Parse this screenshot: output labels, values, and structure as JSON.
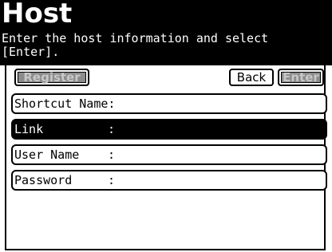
{
  "header": {
    "title": "Host",
    "instruction": "Enter the host information and select\n[Enter]."
  },
  "toolbar": {
    "register_label": "Register",
    "back_label": "Back",
    "enter_label": "Enter"
  },
  "fields": {
    "shortcut_name": {
      "label": "Shortcut Name:",
      "value": ""
    },
    "link": {
      "label": "Link",
      "separator": ":",
      "value": ""
    },
    "user_name": {
      "label": "User Name",
      "separator": ":",
      "value": ""
    },
    "password": {
      "label": "Password",
      "separator": ":",
      "value": ""
    }
  },
  "colors": {
    "header_bg": "#000000",
    "selected_row_bg": "#000000",
    "disabled_button_bg": "#8c8c8c"
  }
}
